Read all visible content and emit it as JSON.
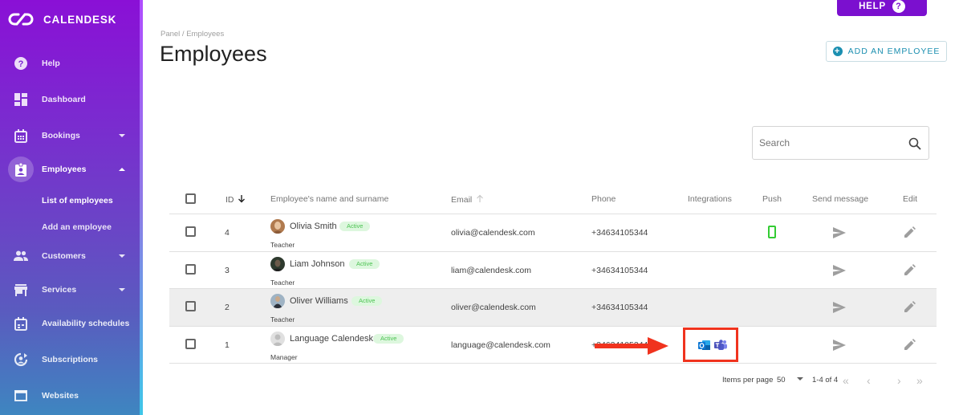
{
  "app": {
    "brand": "CALENDESK",
    "help_button": "HELP"
  },
  "sidebar": {
    "items": [
      {
        "label": "Help",
        "icon": "help-circle-icon"
      },
      {
        "label": "Dashboard",
        "icon": "dashboard-icon"
      },
      {
        "label": "Bookings",
        "icon": "calendar-icon",
        "expandable": true
      },
      {
        "label": "Employees",
        "icon": "badge-icon",
        "expandable": true,
        "expanded": true,
        "active": true
      },
      {
        "label": "Customers",
        "icon": "people-icon",
        "expandable": true
      },
      {
        "label": "Services",
        "icon": "store-icon",
        "expandable": true
      },
      {
        "label": "Availability schedules",
        "icon": "calendar-schedule-icon"
      },
      {
        "label": "Subscriptions",
        "icon": "account-sync-icon"
      },
      {
        "label": "Websites",
        "icon": "browser-window-icon"
      }
    ],
    "sub_items": [
      {
        "label": "List of employees",
        "active": true
      },
      {
        "label": "Add an employee"
      }
    ]
  },
  "header": {
    "breadcrumb": "Panel / Employees",
    "title": "Employees",
    "add_button": "ADD AN EMPLOYEE"
  },
  "search": {
    "placeholder": "Search",
    "value": ""
  },
  "table": {
    "columns": {
      "id": "ID",
      "name": "Employee's name and surname",
      "email": "Email",
      "phone": "Phone",
      "integrations": "Integrations",
      "push": "Push",
      "send_message": "Send message",
      "edit": "Edit"
    },
    "sort": {
      "id": "descending",
      "email": "ascending-inactive"
    },
    "rows": [
      {
        "id": "4",
        "name": "Olivia Smith",
        "status": "Active",
        "role": "Teacher",
        "email": "olivia@calendesk.com",
        "phone": "+34634105344",
        "integrations": [],
        "push": true
      },
      {
        "id": "3",
        "name": "Liam Johnson",
        "status": "Active",
        "role": "Teacher",
        "email": "liam@calendesk.com",
        "phone": "+34634105344",
        "integrations": [],
        "push": false
      },
      {
        "id": "2",
        "name": "Oliver Williams",
        "status": "Active",
        "role": "Teacher",
        "email": "oliver@calendesk.com",
        "phone": "+34634105344",
        "integrations": [],
        "push": false
      },
      {
        "id": "1",
        "name": "Language Calendesk",
        "status": "Active",
        "role": "Manager",
        "email": "language@calendesk.com",
        "phone": "+34634105344",
        "integrations": [
          "outlook",
          "teams"
        ],
        "push": false
      }
    ]
  },
  "pagination": {
    "items_per_page_label": "Items per page",
    "items_per_page": "50",
    "range": "1-4 of 4"
  },
  "colors": {
    "brand_purple": "#7b10cf",
    "accent_teal": "#1b8fb0",
    "active_badge": "#4cc352",
    "annotation_red": "#f0331e"
  }
}
